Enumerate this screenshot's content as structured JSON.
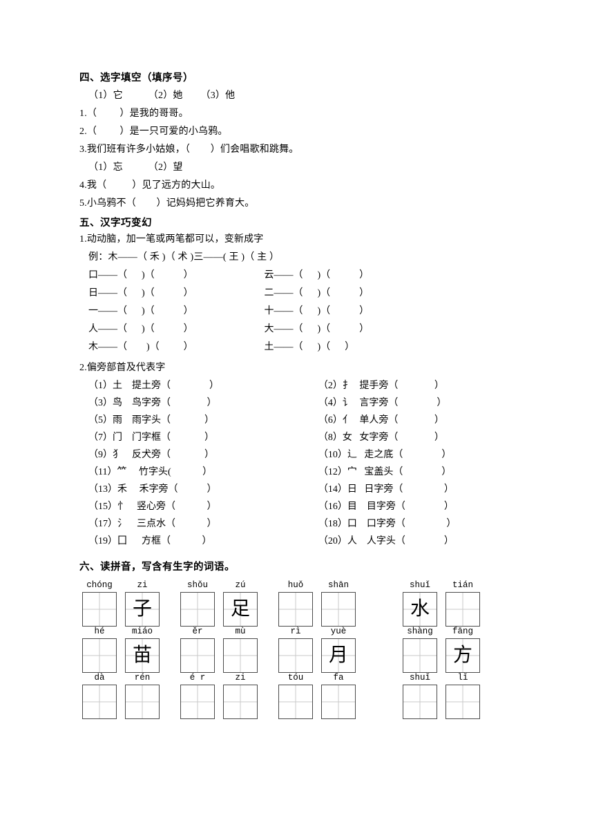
{
  "section4": {
    "heading": "四、选字填空（填序号）",
    "options_a": "（1）它          （2）她       （3）他",
    "items_a": [
      "1.（         ）是我的哥哥。",
      "2.（         ）是一只可爱的小乌鸦。",
      "3.我们班有许多小姑娘，（        ）们会唱歌和跳舞。"
    ],
    "options_b": "（1）忘          （2）望",
    "items_b": [
      "4.我（          ）见了远方的大山。",
      "5.小乌鸦不（        ）记妈妈把它养育大。"
    ]
  },
  "section5": {
    "heading": "五、汉字巧变幻",
    "task1_title": "1.动动脑，加一笔或两笔都可以，变新成字",
    "example": "例：木——（ 禾 )（ 术 )三——( 王 )（ 主 ）",
    "transform_rows": [
      {
        "left": "口——（      )（            ）",
        "right": "云——（      )（            ）"
      },
      {
        "left": "日——（      )（            ）",
        "right": "二——（      )（            ）"
      },
      {
        "left": "一——（      )（            ）",
        "right": "十——（      )（            ）"
      },
      {
        "left": "人——（      )（            ）",
        "right": "大——（      )（            ）"
      },
      {
        "left": "木——（        )（          ）",
        "right": "土——（      )（      ）"
      }
    ],
    "task2_title": "2.偏旁部首及代表字",
    "radicals": [
      {
        "left": "（1）土    提土旁（                ）",
        "right": "（2）扌   提手旁（               ）"
      },
      {
        "left": "（3）鸟    鸟字旁（               ）",
        "right": "（4）讠   言字旁（                ）"
      },
      {
        "left": "（5）雨    雨字头（              ）",
        "right": "（6）亻   单人旁（               ）"
      },
      {
        "left": "（7）门    门字框（              ）",
        "right": "（8）女   女字旁（               ）"
      },
      {
        "left": "（9）犭    反犬旁（              ）",
        "right": "（10）辶   走之底（                ）"
      },
      {
        "left": "（11）⺮     竹字头(             ）",
        "right": "（12）宀   宝盖头（                ）"
      },
      {
        "left": "（13）禾     禾字旁（            ）",
        "right": "（14）日   日字旁（                 ）"
      },
      {
        "left": "（15）忄    竖心旁（             ）",
        "right": "（16）目    目字旁（                ）"
      },
      {
        "left": "（17）氵    三点水（             ）",
        "right": "（18）口    口字旁（                 ）"
      },
      {
        "left": "（19）囗      方框（             ）",
        "right": "（20）人    人字头（                ）"
      }
    ]
  },
  "section6": {
    "heading": "六、读拼音，写含有生字的词语。",
    "rows": [
      {
        "groups": [
          {
            "cells": [
              {
                "pinyin": "chóng",
                "char": ""
              },
              {
                "pinyin": "zi",
                "char": "子"
              }
            ]
          },
          {
            "cells": [
              {
                "pinyin": "shǒu",
                "char": ""
              },
              {
                "pinyin": "zú",
                "char": "足"
              }
            ]
          },
          {
            "cells": [
              {
                "pinyin": "huǒ",
                "char": ""
              },
              {
                "pinyin": "shān",
                "char": ""
              }
            ]
          },
          {
            "cells": [
              {
                "pinyin": "shuǐ",
                "char": "水"
              },
              {
                "pinyin": "tián",
                "char": ""
              }
            ]
          }
        ]
      },
      {
        "groups": [
          {
            "cells": [
              {
                "pinyin": "hé",
                "char": ""
              },
              {
                "pinyin": "miáo",
                "char": "苗"
              }
            ]
          },
          {
            "cells": [
              {
                "pinyin": "ěr",
                "char": ""
              },
              {
                "pinyin": "mù",
                "char": ""
              }
            ]
          },
          {
            "cells": [
              {
                "pinyin": "rì",
                "char": ""
              },
              {
                "pinyin": "yuè",
                "char": "月"
              }
            ]
          },
          {
            "cells": [
              {
                "pinyin": "shàng",
                "char": ""
              },
              {
                "pinyin": "fāng",
                "char": "方"
              }
            ]
          }
        ]
      },
      {
        "groups": [
          {
            "cells": [
              {
                "pinyin": "dà",
                "char": ""
              },
              {
                "pinyin": "rén",
                "char": ""
              }
            ]
          },
          {
            "cells": [
              {
                "pinyin": "é r",
                "char": ""
              },
              {
                "pinyin": "zi",
                "char": ""
              }
            ]
          },
          {
            "cells": [
              {
                "pinyin": "tóu",
                "char": ""
              },
              {
                "pinyin": "fa",
                "char": ""
              }
            ]
          },
          {
            "cells": [
              {
                "pinyin": "shuǐ",
                "char": ""
              },
              {
                "pinyin": "lǐ",
                "char": ""
              }
            ]
          }
        ]
      }
    ]
  }
}
